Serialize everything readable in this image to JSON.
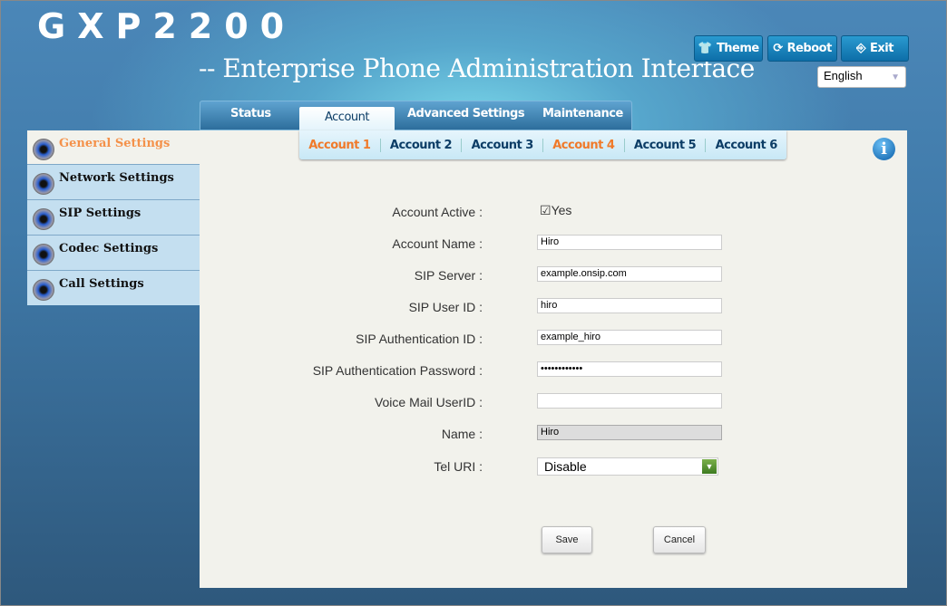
{
  "header": {
    "logo": "GXP2200",
    "subtitle": "-- Enterprise Phone Administration Interface",
    "buttons": {
      "theme": "Theme",
      "reboot": "Reboot",
      "exit": "Exit"
    },
    "language": "English"
  },
  "tabs": [
    {
      "label": "Status"
    },
    {
      "label": "Account"
    },
    {
      "label": "Advanced Settings"
    },
    {
      "label": "Maintenance"
    }
  ],
  "subtabs": [
    {
      "label": "Account 1"
    },
    {
      "label": "Account 2"
    },
    {
      "label": "Account 3"
    },
    {
      "label": "Account 4"
    },
    {
      "label": "Account 5"
    },
    {
      "label": "Account 6"
    }
  ],
  "sidebar": {
    "items": [
      {
        "label": "General Settings"
      },
      {
        "label": "Network Settings"
      },
      {
        "label": "SIP Settings"
      },
      {
        "label": "Codec Settings"
      },
      {
        "label": "Call Settings"
      }
    ]
  },
  "form": {
    "account_active": {
      "label": "Account Active :",
      "value": "Yes",
      "checked": true
    },
    "account_name": {
      "label": "Account Name :",
      "value": "Hiro"
    },
    "sip_server": {
      "label": "SIP Server :",
      "value": "example.onsip.com"
    },
    "sip_user_id": {
      "label": "SIP User ID :",
      "value": "hiro"
    },
    "sip_auth_id": {
      "label": "SIP Authentication ID :",
      "value": "example_hiro"
    },
    "sip_auth_password": {
      "label": "SIP Authentication Password :",
      "value": "••••••••••••"
    },
    "voice_mail_user_id": {
      "label": "Voice Mail UserID :",
      "value": ""
    },
    "name": {
      "label": "Name :",
      "value": "Hiro"
    },
    "tel_uri": {
      "label": "Tel URI :",
      "value": "Disable"
    }
  },
  "actions": {
    "save": "Save",
    "cancel": "Cancel"
  }
}
